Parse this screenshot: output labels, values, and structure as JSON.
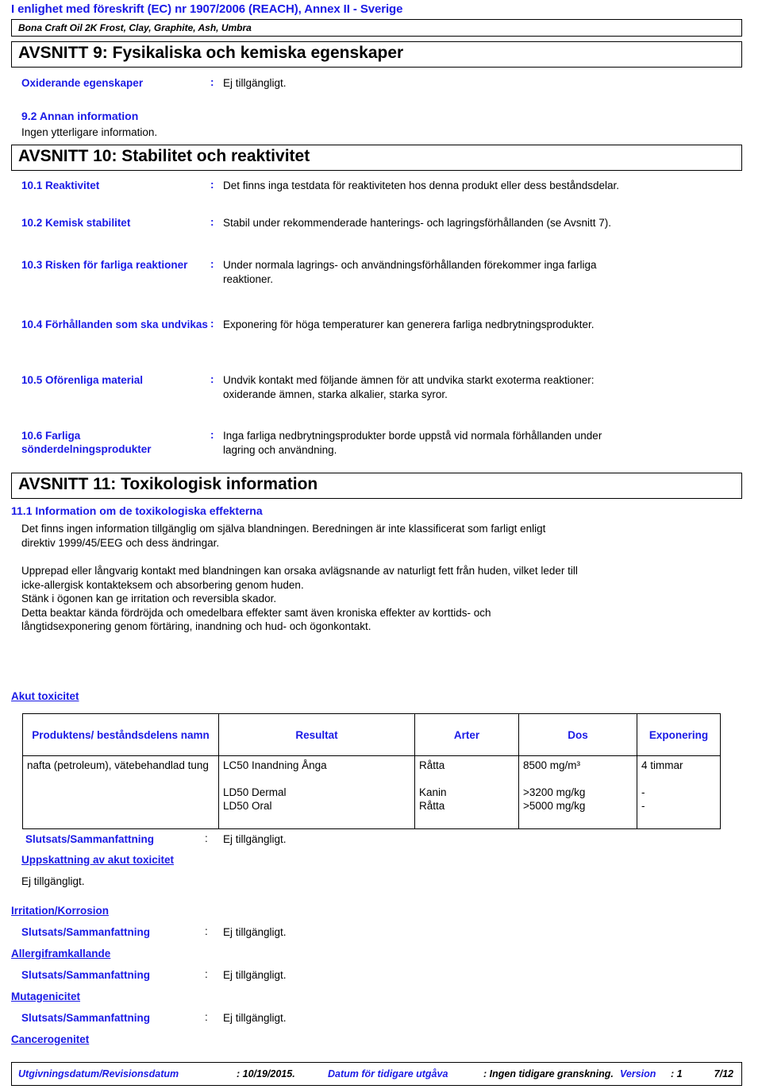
{
  "header": {
    "regulation_line": "I enlighet med föreskrift (EC) nr 1907/2006 (REACH), Annex II - Sverige",
    "product_name": "Bona Craft Oil 2K Frost, Clay, Graphite, Ash, Umbra"
  },
  "section9": {
    "title": "AVSNITT 9: Fysikaliska och kemiska egenskaper",
    "rows": [
      {
        "label": "Oxiderande egenskaper",
        "colon": ":",
        "value": "Ej tillgängligt."
      }
    ],
    "sub_9_2": {
      "heading": "9.2 Annan information",
      "text": "Ingen ytterligare information."
    }
  },
  "section10": {
    "title": "AVSNITT 10: Stabilitet och reaktivitet",
    "rows": [
      {
        "label": "10.1 Reaktivitet",
        "colon": ":",
        "value": "Det finns inga testdata för reaktiviteten hos denna produkt eller dess beståndsdelar."
      },
      {
        "label": "10.2 Kemisk stabilitet",
        "colon": ":",
        "value": "Stabil under rekommenderade hanterings- och lagringsförhållanden (se Avsnitt 7)."
      },
      {
        "label": "10.3 Risken för farliga reaktioner",
        "colon": ":",
        "value": "Under normala lagrings- och användningsförhållanden förekommer inga farliga\nreaktioner."
      },
      {
        "label": "10.4 Förhållanden som ska undvikas",
        "colon": ":",
        "value": "Exponering för höga temperaturer kan generera farliga nedbrytningsprodukter."
      },
      {
        "label": "10.5 Oförenliga material",
        "colon": ":",
        "value": "Undvik kontakt med följande ämnen för att undvika starkt exoterma reaktioner:\noxiderande ämnen, starka alkalier, starka syror."
      },
      {
        "label": "10.6 Farliga sönderdelningsprodukter",
        "colon": ":",
        "value": "Inga farliga nedbrytningsprodukter borde uppstå vid normala förhållanden under\nlagring och användning."
      }
    ]
  },
  "section11": {
    "title": "AVSNITT 11: Toxikologisk information",
    "heading_11_1": "11.1 Information om de toxikologiska effekterna",
    "paragraph1": "Det finns ingen information tillgänglig om själva blandningen. Beredningen är inte klassificerat som farligt enligt\ndirektiv 1999/45/EEG och dess ändringar.",
    "paragraph2": "Upprepad eller långvarig kontakt med blandningen kan orsaka avlägsnande av naturligt fett från huden, vilket leder till\nicke-allergisk kontakteksem och absorbering genom huden.\nStänk i ögonen kan ge irritation och reversibla skador.\nDetta beaktar kända fördröjda och omedelbara effekter samt även kroniska effekter av korttids- och\nlångtidsexponering genom förtäring, inandning och hud- och ögonkontakt.",
    "acute_tox_heading": "Akut toxicitet",
    "table": {
      "columns": [
        "Produktens/\nbeståndsdelens namn",
        "Resultat",
        "Arter",
        "Dos",
        "Exponering"
      ],
      "rows": [
        {
          "name": "nafta (petroleum),\nvätebehandlad tung",
          "result_lines": [
            "LC50 Inandning Ånga",
            "",
            "LD50 Dermal",
            "LD50 Oral"
          ],
          "species_lines": [
            "Råtta",
            "",
            "Kanin",
            "Råtta"
          ],
          "dose_lines": [
            "8500 mg/m³",
            "",
            ">3200 mg/kg",
            ">5000 mg/kg"
          ],
          "exposure_lines": [
            "4 timmar",
            "",
            "-",
            "-"
          ]
        }
      ]
    },
    "conclusions": [
      {
        "label": "Slutsats/Sammanfattning",
        "colon": ":",
        "value": "Ej tillgängligt."
      }
    ],
    "estimate_heading": "Uppskattning av akut toxicitet",
    "estimate_value": "Ej tillgängligt.",
    "blocks": [
      {
        "heading": "Irritation/Korrosion",
        "label": "Slutsats/Sammanfattning",
        "colon": ":",
        "value": "Ej tillgängligt."
      },
      {
        "heading": "Allergiframkallande",
        "label": "Slutsats/Sammanfattning",
        "colon": ":",
        "value": "Ej tillgängligt."
      },
      {
        "heading": "Mutagenicitet",
        "label": "Slutsats/Sammanfattning",
        "colon": ":",
        "value": "Ej tillgängligt."
      },
      {
        "heading": "Cancerogenitet",
        "label": "",
        "colon": "",
        "value": ""
      }
    ]
  },
  "footer": {
    "issue_label": "Utgivningsdatum/Revisionsdatum",
    "issue_colon_value": ": 10/19/2015.",
    "previous_label": "Datum för tidigare utgåva",
    "previous_colon_value": ": Ingen tidigare granskning.",
    "version_label": "Version",
    "version_colon_value": ": 1",
    "page": "7/12"
  },
  "colors": {
    "accent_blue": "#1a1ae6",
    "text_black": "#000000",
    "border": "#000000"
  }
}
